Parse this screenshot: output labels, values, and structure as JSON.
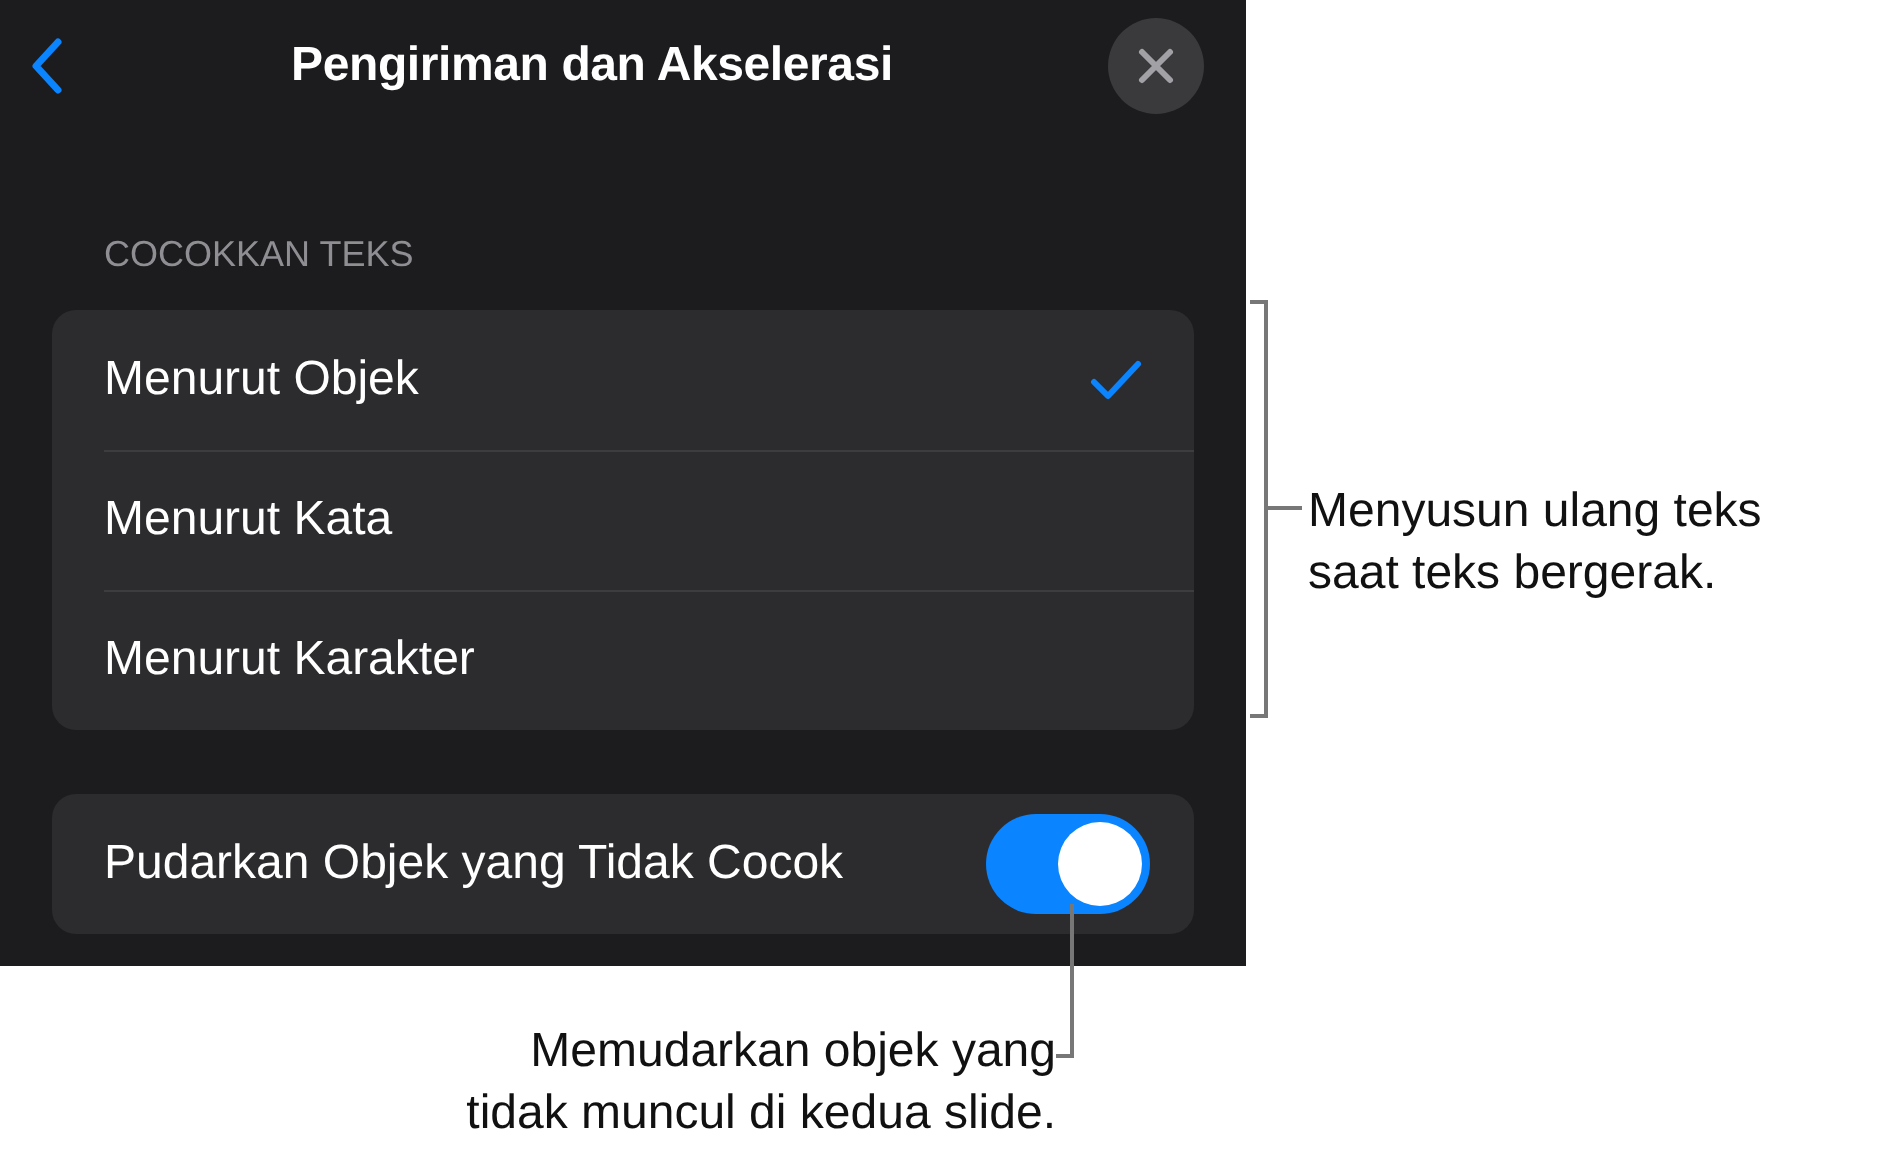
{
  "header": {
    "title": "Pengiriman dan Akselerasi"
  },
  "section": {
    "heading": "COCOKKAN TEKS",
    "options": [
      {
        "label": "Menurut Objek",
        "selected": true
      },
      {
        "label": "Menurut Kata",
        "selected": false
      },
      {
        "label": "Menurut Karakter",
        "selected": false
      }
    ]
  },
  "toggle": {
    "label": "Pudarkan Objek yang Tidak Cocok",
    "on": true
  },
  "callouts": [
    {
      "kind": "bracket",
      "text": "Menyusun ulang teks\nsaat teks bergerak."
    },
    {
      "kind": "pointer",
      "text": "Memudarkan objek yang\ntidak muncul di kedua slide."
    }
  ]
}
